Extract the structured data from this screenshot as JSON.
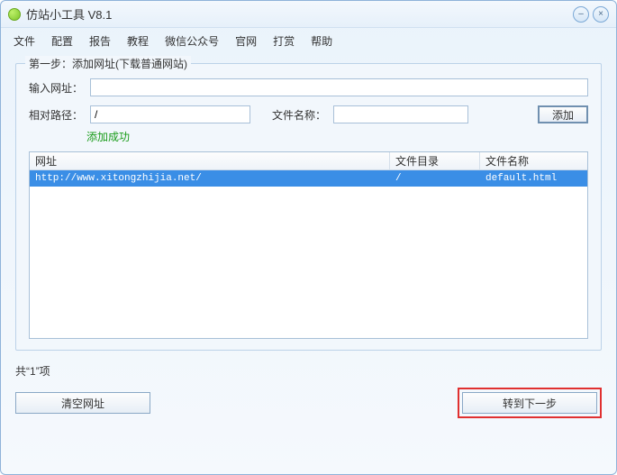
{
  "window": {
    "title": "仿站小工具 V8.1"
  },
  "win_controls": {
    "minimize": "–",
    "close": "×"
  },
  "menu": {
    "items": [
      {
        "label": "文件"
      },
      {
        "label": "配置"
      },
      {
        "label": "报告"
      },
      {
        "label": "教程"
      },
      {
        "label": "微信公众号"
      },
      {
        "label": "官网"
      },
      {
        "label": "打赏"
      },
      {
        "label": "帮助"
      }
    ]
  },
  "step1": {
    "legend": "第一步：添加网址(下载普通网站)",
    "input_url_label": "输入网址：",
    "input_url_value": "",
    "relative_path_label": "相对路径：",
    "relative_path_value": "/",
    "file_name_label": "文件名称：",
    "file_name_value": "",
    "add_button": "添加",
    "success_msg": "添加成功"
  },
  "table": {
    "headers": {
      "col1": "网址",
      "col2": "文件目录",
      "col3": "文件名称"
    },
    "rows": [
      {
        "url": "http://www.xitongzhijia.net/",
        "dir": "/",
        "fname": "default.html"
      }
    ]
  },
  "footer": {
    "count_prefix": "共“",
    "count_value": "1",
    "count_suffix": "”项",
    "clear_button": "清空网址",
    "next_button": "转到下一步"
  }
}
